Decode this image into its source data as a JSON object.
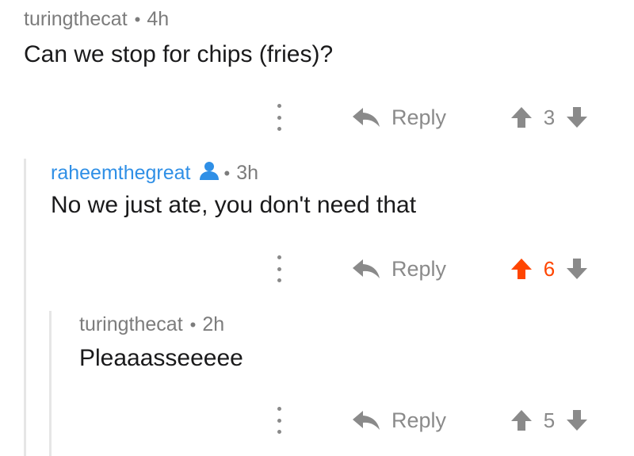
{
  "comments": [
    {
      "author": "turingthecat",
      "age": "4h",
      "text": "Can we stop for chips (fries)?",
      "reply_label": "Reply",
      "score": "3",
      "upvoted": false
    },
    {
      "author": "raheemthegreat",
      "age": "3h",
      "text": "No we just ate, you don't need that",
      "reply_label": "Reply",
      "score": "6",
      "upvoted": true,
      "is_op": true
    },
    {
      "author": "turingthecat",
      "age": "2h",
      "text": "Pleaaasseeeee",
      "reply_label": "Reply",
      "score": "5",
      "upvoted": false
    }
  ],
  "separator": "•",
  "colors": {
    "op_author": "#2f8fe6",
    "upvote_active": "#ff4500",
    "muted": "#8a8a8a",
    "thread_line": "#e6e6e6"
  },
  "icons": {
    "more": "more-vertical-icon",
    "reply": "reply-arrow-icon",
    "upvote": "upvote-arrow-icon",
    "downvote": "downvote-arrow-icon",
    "op_badge": "user-icon"
  }
}
